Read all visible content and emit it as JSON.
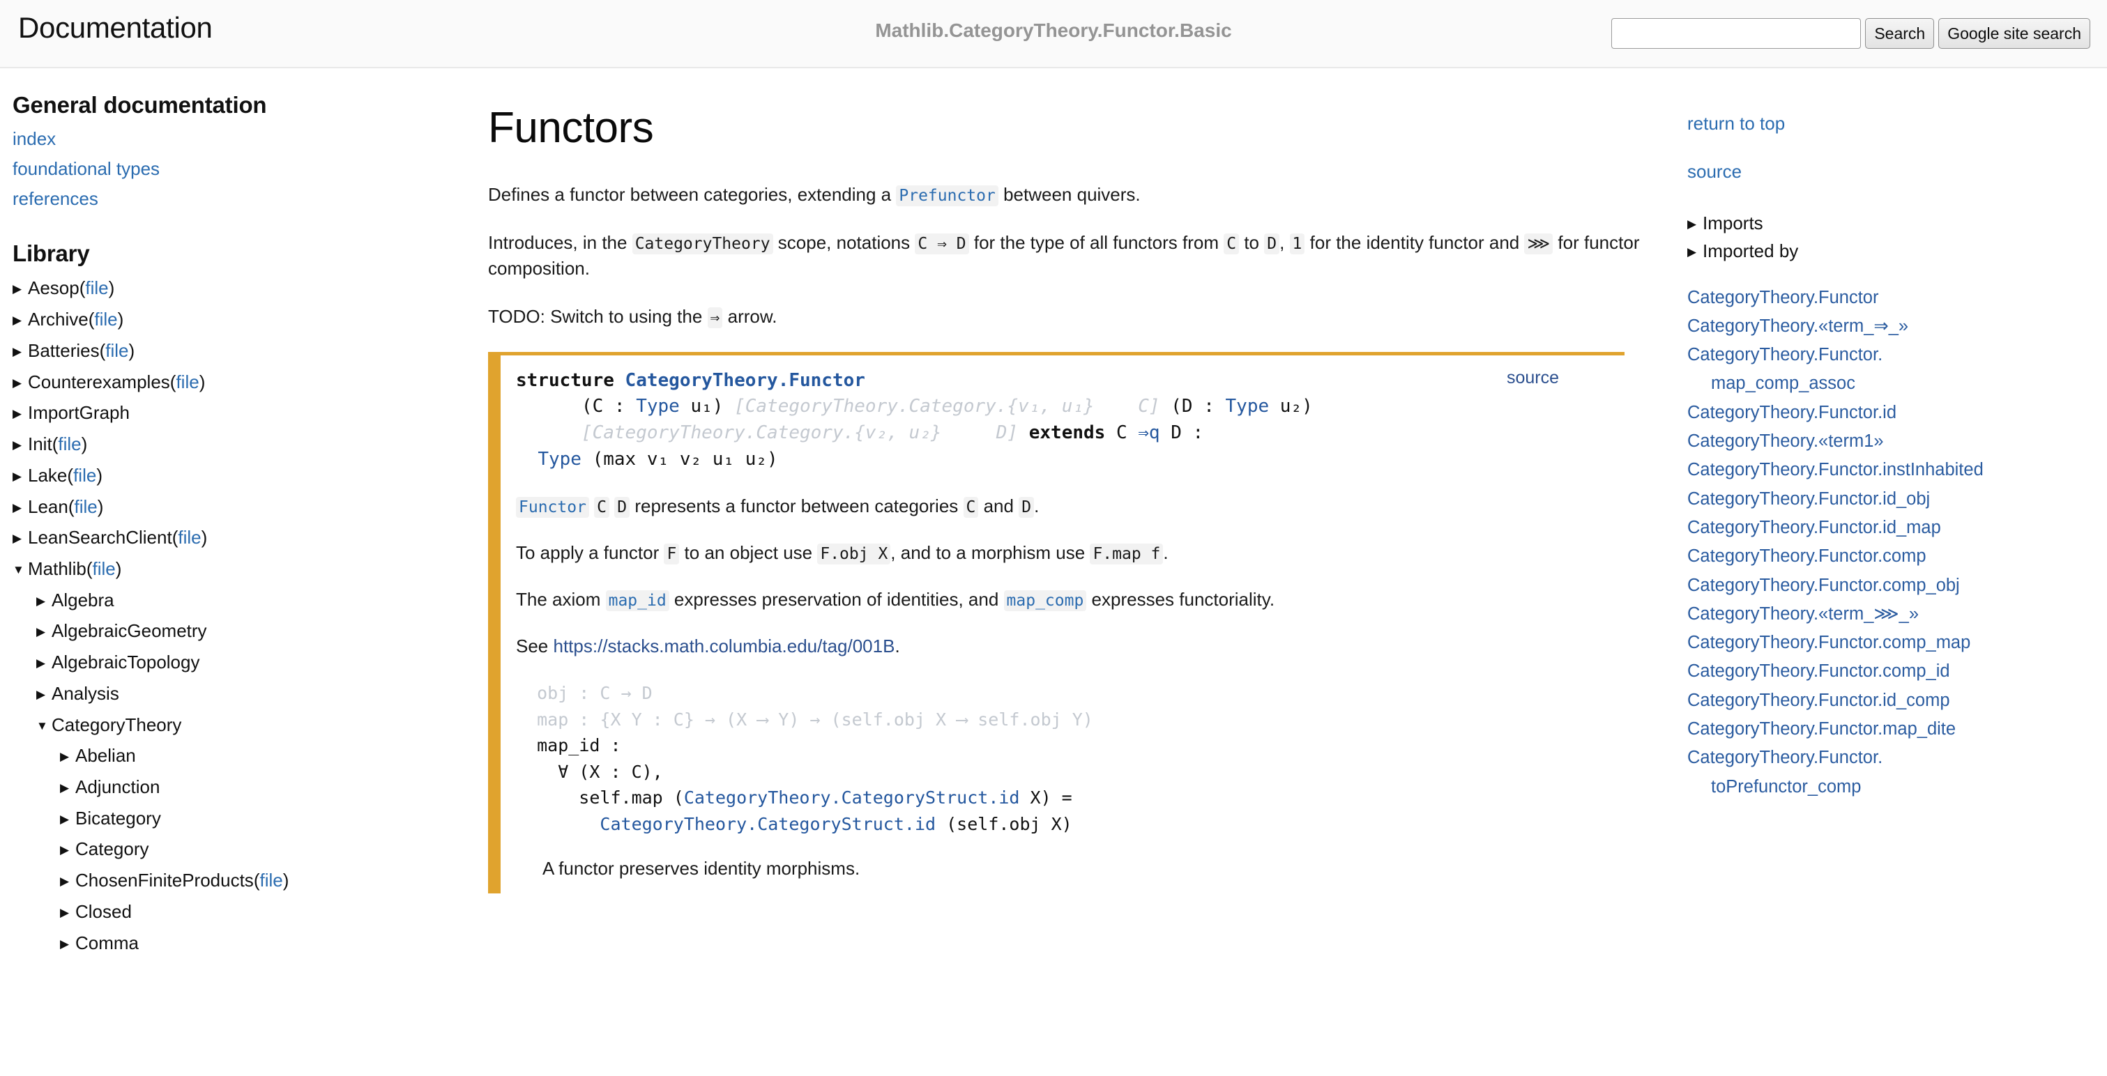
{
  "header": {
    "brand": "Documentation",
    "module_title": "Mathlib.CategoryTheory.Functor.Basic",
    "search_value": "",
    "search_placeholder": "",
    "search_button": "Search",
    "google_button": "Google site search"
  },
  "left_nav": {
    "general_heading": "General documentation",
    "general_links": [
      "index",
      "foundational types",
      "references"
    ],
    "library_heading": "Library",
    "file_label": "file",
    "tree": [
      {
        "level": 0,
        "caret": "collapsed",
        "label": "Aesop",
        "file": true
      },
      {
        "level": 0,
        "caret": "collapsed",
        "label": "Archive",
        "file": true
      },
      {
        "level": 0,
        "caret": "collapsed",
        "label": "Batteries",
        "file": true
      },
      {
        "level": 0,
        "caret": "collapsed",
        "label": "Counterexamples",
        "file": true
      },
      {
        "level": 0,
        "caret": "collapsed",
        "label": "ImportGraph",
        "file": false
      },
      {
        "level": 0,
        "caret": "collapsed",
        "label": "Init",
        "file": true
      },
      {
        "level": 0,
        "caret": "collapsed",
        "label": "Lake",
        "file": true
      },
      {
        "level": 0,
        "caret": "collapsed",
        "label": "Lean",
        "file": true
      },
      {
        "level": 0,
        "caret": "collapsed",
        "label": "LeanSearchClient",
        "file": true
      },
      {
        "level": 0,
        "caret": "expanded",
        "label": "Mathlib",
        "file": true
      },
      {
        "level": 1,
        "caret": "collapsed",
        "label": "Algebra",
        "file": false
      },
      {
        "level": 1,
        "caret": "collapsed",
        "label": "AlgebraicGeometry",
        "file": false
      },
      {
        "level": 1,
        "caret": "collapsed",
        "label": "AlgebraicTopology",
        "file": false
      },
      {
        "level": 1,
        "caret": "collapsed",
        "label": "Analysis",
        "file": false
      },
      {
        "level": 1,
        "caret": "expanded",
        "label": "CategoryTheory",
        "file": false
      },
      {
        "level": 2,
        "caret": "collapsed",
        "label": "Abelian",
        "file": false
      },
      {
        "level": 2,
        "caret": "collapsed",
        "label": "Adjunction",
        "file": false
      },
      {
        "level": 2,
        "caret": "collapsed",
        "label": "Bicategory",
        "file": false
      },
      {
        "level": 2,
        "caret": "collapsed",
        "label": "Category",
        "file": false
      },
      {
        "level": 2,
        "caret": "collapsed",
        "label": "ChosenFiniteProducts",
        "file": true
      },
      {
        "level": 2,
        "caret": "collapsed",
        "label": "Closed",
        "file": false
      },
      {
        "level": 2,
        "caret": "collapsed",
        "label": "Comma",
        "file": false
      }
    ]
  },
  "main": {
    "page_title": "Functors",
    "intro_1_a": "Defines a functor between categories, extending a ",
    "intro_1_code": "Prefunctor",
    "intro_1_b": " between quivers.",
    "intro_2_a": "Introduces, in the ",
    "intro_2_code1": "CategoryTheory",
    "intro_2_b": " scope, notations ",
    "intro_2_code2": "C ⇒ D",
    "intro_2_c": " for the type of all functors from ",
    "intro_2_code3": "C",
    "intro_2_d": " to ",
    "intro_2_code4": "D",
    "intro_2_e": ", ",
    "intro_2_code5": "1",
    "intro_2_f": " for the identity functor and ",
    "intro_2_code6": "⋙",
    "intro_2_g": " for functor composition.",
    "intro_3_a": "TODO: Switch to using the ",
    "intro_3_code": "⇒",
    "intro_3_b": " arrow."
  },
  "declaration": {
    "source_label": "source",
    "keyword": "structure",
    "name": "CategoryTheory.Functor",
    "sig_line2_p1": "      (C : ",
    "sig_line2_type1": "Type",
    "sig_line2_p2": " u₁) ",
    "sig_line2_dim1": "[CategoryTheory.Category.{v₁, u₁}",
    "sig_line2_dim2": "C]",
    "sig_line2_p3": " (D : ",
    "sig_line2_type2": "Type",
    "sig_line2_p4": " u₂)",
    "sig_line3_dim1": "[CategoryTheory.Category.{v₂, u₂}",
    "sig_line3_dim2": "D]",
    "sig_line3_kw": "extends",
    "sig_line3_p1": " C ",
    "sig_line3_arrow": "⇒q",
    "sig_line3_p2": " D :",
    "sig_line4_type": "Type",
    "sig_line4_rest": " (max v₁ v₂ u₁ u₂)",
    "doc_1_code": "Functor",
    "doc_1_a": " ",
    "doc_1_code2": "C",
    "doc_1_b": " ",
    "doc_1_code3": "D",
    "doc_1_c": " represents a functor between categories ",
    "doc_1_code4": "C",
    "doc_1_d": " and ",
    "doc_1_code5": "D",
    "doc_1_e": ".",
    "doc_2_a": "To apply a functor ",
    "doc_2_code1": "F",
    "doc_2_b": " to an object use ",
    "doc_2_code2": "F.obj X",
    "doc_2_c": ", and to a morphism use ",
    "doc_2_code3": "F.map f",
    "doc_2_d": ".",
    "doc_3_a": "The axiom ",
    "doc_3_code1": "map_id",
    "doc_3_b": " expresses preservation of identities, and ",
    "doc_3_code2": "map_comp",
    "doc_3_c": " expresses functoriality.",
    "doc_4_a": "See ",
    "doc_4_link": "https://stacks.math.columbia.edu/tag/001B",
    "doc_4_b": ".",
    "field_obj": "  obj : C → D",
    "field_map": "  map : {X Y : C} → (X ⟶ Y) → (self.obj X ⟶ self.obj Y)",
    "field_map_id_name": "map_id :",
    "field_map_id_l1": "    ∀ (X : C),",
    "field_map_id_l2_p1": "      self.map (",
    "field_map_id_l2_lnk": "CategoryTheory.CategoryStruct.id",
    "field_map_id_l2_p2": " X) =",
    "field_map_id_l3_lnk": "CategoryTheory.CategoryStruct.id",
    "field_map_id_l3_p1": " (self.obj X)",
    "field_note": "A functor preserves identity morphisms."
  },
  "right_nav": {
    "return_to_top": "return to top",
    "source": "source",
    "imports": "Imports",
    "imported_by": "Imported by",
    "declarations": [
      {
        "text": "CategoryTheory.Functor",
        "wrap": null
      },
      {
        "text": "CategoryTheory.«term_⇒_»",
        "wrap": null
      },
      {
        "text": "CategoryTheory.Functor.",
        "wrap": "map_comp_assoc"
      },
      {
        "text": "CategoryTheory.Functor.id",
        "wrap": null
      },
      {
        "text": "CategoryTheory.«term1»",
        "wrap": null
      },
      {
        "text": "CategoryTheory.Functor.instInhabited",
        "wrap": null
      },
      {
        "text": "CategoryTheory.Functor.id_obj",
        "wrap": null
      },
      {
        "text": "CategoryTheory.Functor.id_map",
        "wrap": null
      },
      {
        "text": "CategoryTheory.Functor.comp",
        "wrap": null
      },
      {
        "text": "CategoryTheory.Functor.comp_obj",
        "wrap": null
      },
      {
        "text": "CategoryTheory.«term_⋙_»",
        "wrap": null
      },
      {
        "text": "CategoryTheory.Functor.comp_map",
        "wrap": null
      },
      {
        "text": "CategoryTheory.Functor.comp_id",
        "wrap": null
      },
      {
        "text": "CategoryTheory.Functor.id_comp",
        "wrap": null
      },
      {
        "text": "CategoryTheory.Functor.map_dite",
        "wrap": null
      },
      {
        "text": "CategoryTheory.Functor.",
        "wrap": "toPrefunctor_comp"
      }
    ]
  },
  "icons": {
    "caret_collapsed": "▶",
    "caret_expanded": "▼"
  },
  "colors": {
    "link": "#2b6cb0",
    "accent_border": "#e0a32e",
    "muted": "#949494",
    "code_bg": "#f2f2f2"
  }
}
